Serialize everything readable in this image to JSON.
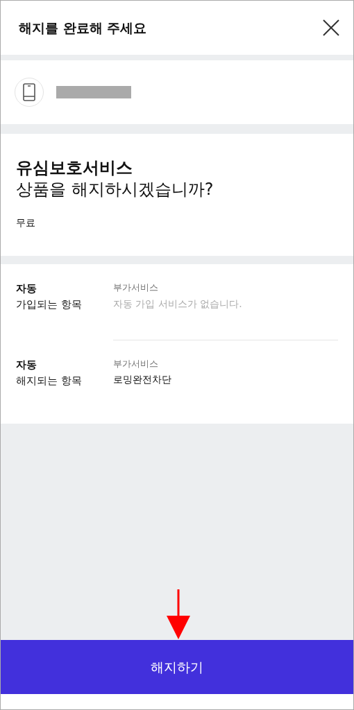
{
  "header": {
    "title": "해지를 완료해 주세요"
  },
  "product": {
    "name": "유심보호서비스",
    "question": "상품을 해지하시겠습니까?",
    "price": "무료"
  },
  "items": [
    {
      "label_top": "자동",
      "label_bottom": "가입되는 항목",
      "category": "부가서비스",
      "value": "자동 가입 서비스가 없습니다.",
      "empty": true
    },
    {
      "label_top": "자동",
      "label_bottom": "해지되는 항목",
      "category": "부가서비스",
      "value": "로밍완전차단",
      "empty": false
    }
  ],
  "confirm_button": "해지하기"
}
